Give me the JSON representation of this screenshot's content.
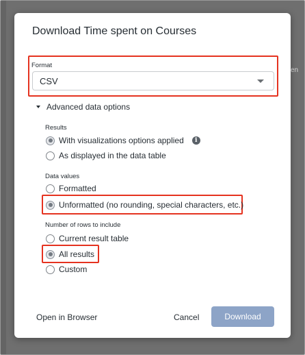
{
  "background": {
    "peek_text": "en"
  },
  "dialog": {
    "title": "Download Time spent on Courses",
    "format": {
      "label": "Format",
      "selected": "CSV"
    },
    "advanced_toggle": "Advanced data options",
    "results": {
      "label": "Results",
      "options": [
        {
          "label": "With visualizations options applied",
          "checked": true
        },
        {
          "label": "As displayed in the data table",
          "checked": false
        }
      ]
    },
    "data_values": {
      "label": "Data values",
      "options": [
        {
          "label": "Formatted",
          "checked": false
        },
        {
          "label": "Unformatted (no rounding, special characters, etc.)",
          "checked": true
        }
      ]
    },
    "rows": {
      "label": "Number of rows to include",
      "options": [
        {
          "label": "Current result table",
          "checked": false
        },
        {
          "label": "All results",
          "checked": true
        },
        {
          "label": "Custom",
          "checked": false
        }
      ]
    },
    "footer": {
      "open_in_browser": "Open in Browser",
      "cancel": "Cancel",
      "download": "Download"
    }
  },
  "colors": {
    "highlight": "#e5321f",
    "download_button": "#8da4c7",
    "backdrop": "#6f6f6f"
  },
  "icons": {
    "info": "info-icon",
    "select_caret": "chevron-down-icon",
    "advanced_caret": "caret-down-icon"
  }
}
